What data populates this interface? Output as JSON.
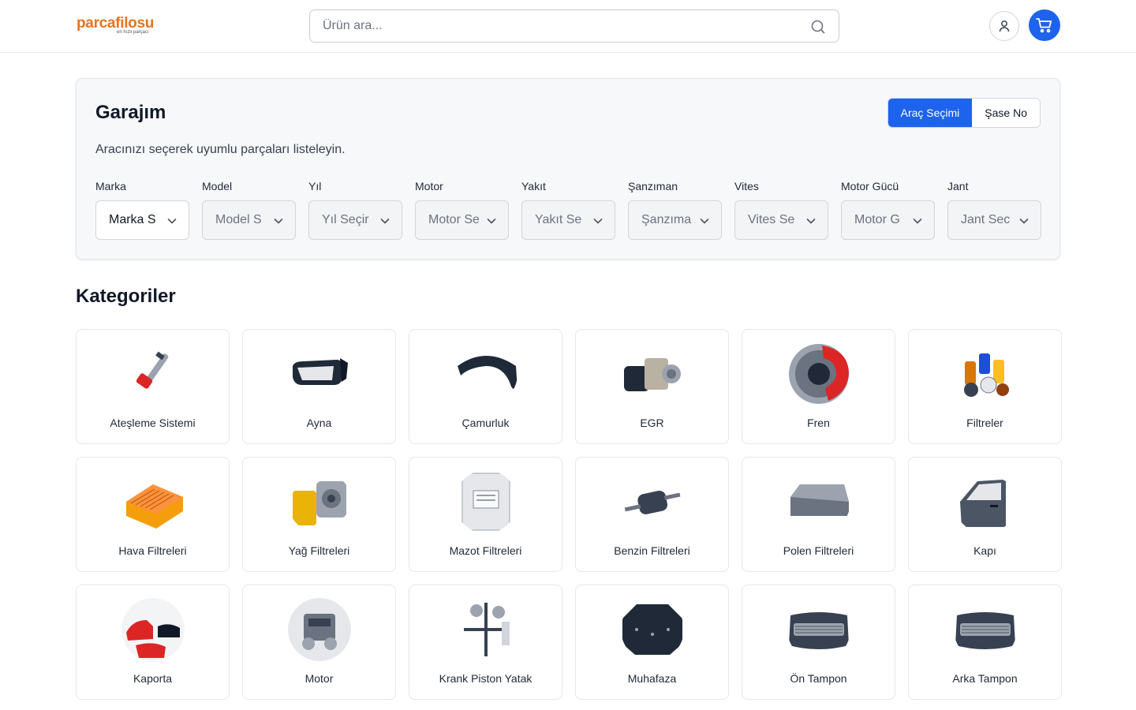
{
  "header": {
    "logo_text": "parcafilosu",
    "logo_tagline": "en hızlı parçacı",
    "search_placeholder": "Ürün ara..."
  },
  "garage": {
    "title": "Garajım",
    "subtitle": "Aracınızı seçerek uyumlu parçaları listeleyin.",
    "tabs": [
      "Araç Seçimi",
      "Şase No"
    ],
    "active_tab": "Araç Seçimi",
    "selects": [
      {
        "label": "Marka",
        "value": "Marka S",
        "enabled": true
      },
      {
        "label": "Model",
        "value": "Model S",
        "enabled": false
      },
      {
        "label": "Yıl",
        "value": "Yıl Seçir",
        "enabled": false
      },
      {
        "label": "Motor",
        "value": "Motor Se",
        "enabled": false
      },
      {
        "label": "Yakıt",
        "value": "Yakıt Se",
        "enabled": false
      },
      {
        "label": "Şanzıman",
        "value": "Şanzıma",
        "enabled": false
      },
      {
        "label": "Vites",
        "value": "Vites Se",
        "enabled": false
      },
      {
        "label": "Motor Gücü",
        "value": "Motor G",
        "enabled": false
      },
      {
        "label": "Jant",
        "value": "Jant Sec",
        "enabled": false
      }
    ]
  },
  "categories": {
    "title": "Kategoriler",
    "items": [
      {
        "label": "Ateşleme Sistemi",
        "icon": "ignition-coil-icon"
      },
      {
        "label": "Ayna",
        "icon": "side-mirror-icon"
      },
      {
        "label": "Çamurluk",
        "icon": "fender-icon"
      },
      {
        "label": "EGR",
        "icon": "egr-valve-icon"
      },
      {
        "label": "Fren",
        "icon": "brake-disc-icon"
      },
      {
        "label": "Filtreler",
        "icon": "filters-icon"
      },
      {
        "label": "Hava Filtreleri",
        "icon": "air-filter-icon"
      },
      {
        "label": "Yağ Filtreleri",
        "icon": "oil-filter-icon"
      },
      {
        "label": "Mazot Filtreleri",
        "icon": "diesel-filter-icon"
      },
      {
        "label": "Benzin Filtreleri",
        "icon": "fuel-filter-icon"
      },
      {
        "label": "Polen Filtreleri",
        "icon": "cabin-filter-icon"
      },
      {
        "label": "Kapı",
        "icon": "car-door-icon"
      },
      {
        "label": "Kaporta",
        "icon": "car-body-icon"
      },
      {
        "label": "Motor",
        "icon": "engine-icon"
      },
      {
        "label": "Krank Piston Yatak",
        "icon": "crank-piston-icon"
      },
      {
        "label": "Muhafaza",
        "icon": "engine-cover-icon"
      },
      {
        "label": "Ön Tampon",
        "icon": "front-bumper-icon"
      },
      {
        "label": "Arka Tampon",
        "icon": "rear-bumper-icon"
      }
    ]
  },
  "colors": {
    "brand_orange": "#e8731c",
    "primary_blue": "#1d63ed",
    "border": "#e5e7eb",
    "panel_bg": "#f7f8fa"
  }
}
